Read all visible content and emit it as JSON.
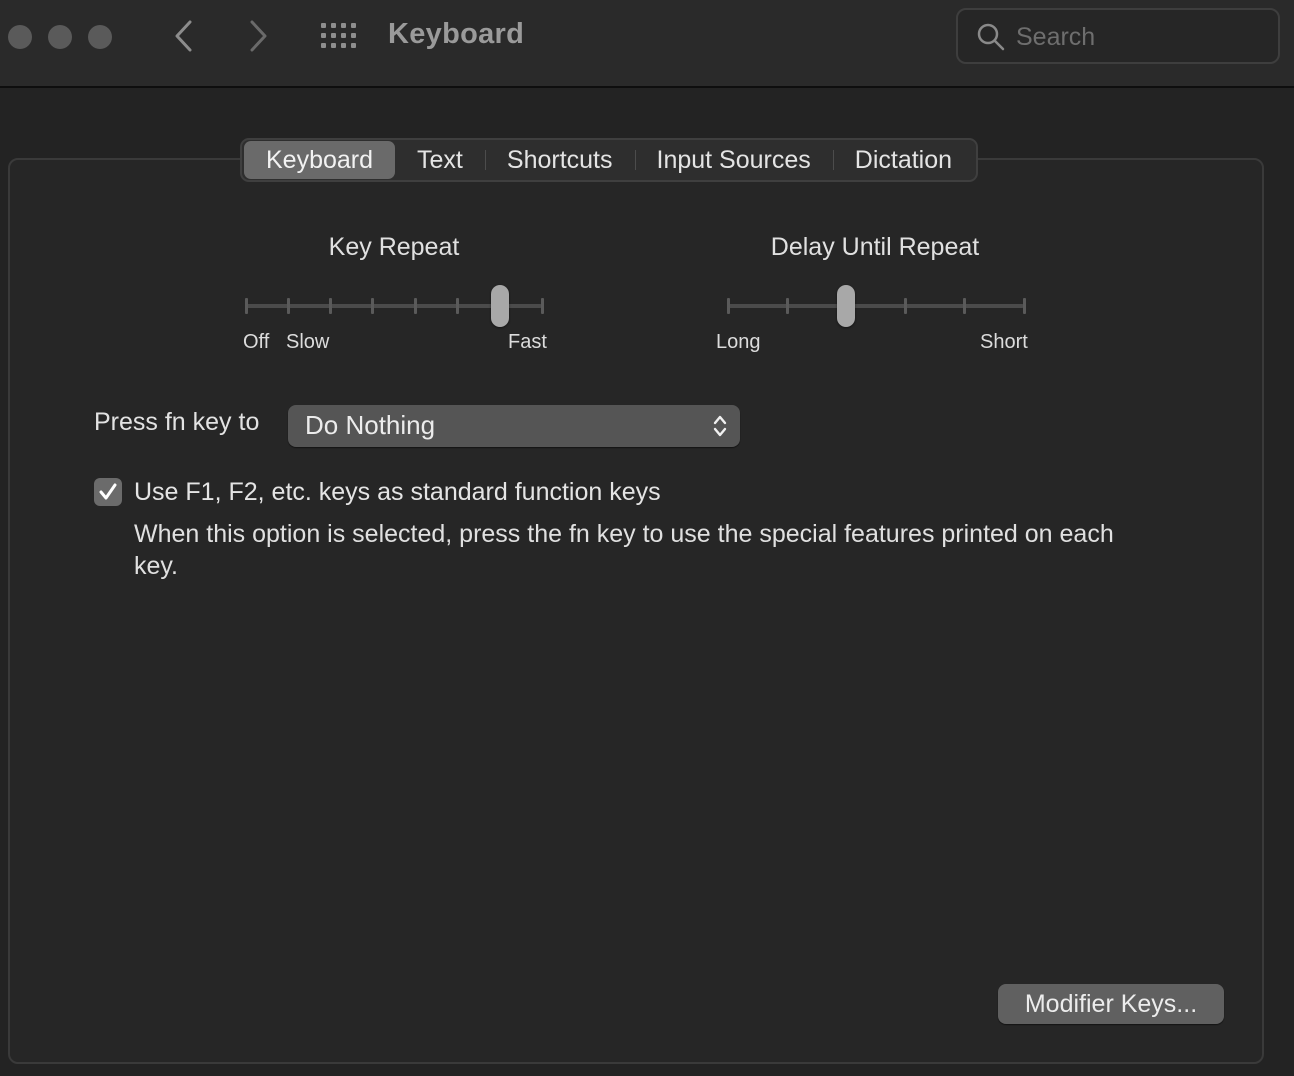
{
  "window": {
    "title": "Keyboard",
    "search_placeholder": "Search"
  },
  "tabs": [
    {
      "label": "Keyboard",
      "active": true
    },
    {
      "label": "Text",
      "active": false
    },
    {
      "label": "Shortcuts",
      "active": false
    },
    {
      "label": "Input Sources",
      "active": false
    },
    {
      "label": "Dictation",
      "active": false
    }
  ],
  "key_repeat": {
    "title": "Key Repeat",
    "labels": {
      "off": "Off",
      "slow": "Slow",
      "fast": "Fast"
    },
    "tick_count": 8,
    "selected_index": 6
  },
  "delay_until_repeat": {
    "title": "Delay Until Repeat",
    "labels": {
      "long": "Long",
      "short": "Short"
    },
    "tick_count": 6,
    "selected_index": 2
  },
  "fn_key": {
    "label": "Press fn key to",
    "selected": "Do Nothing"
  },
  "function_keys": {
    "checked": true,
    "label": "Use F1, F2, etc. keys as standard function keys",
    "description": "When this option is selected, press the fn key to use the special features printed on each key."
  },
  "modifier_keys_button": "Modifier Keys..."
}
